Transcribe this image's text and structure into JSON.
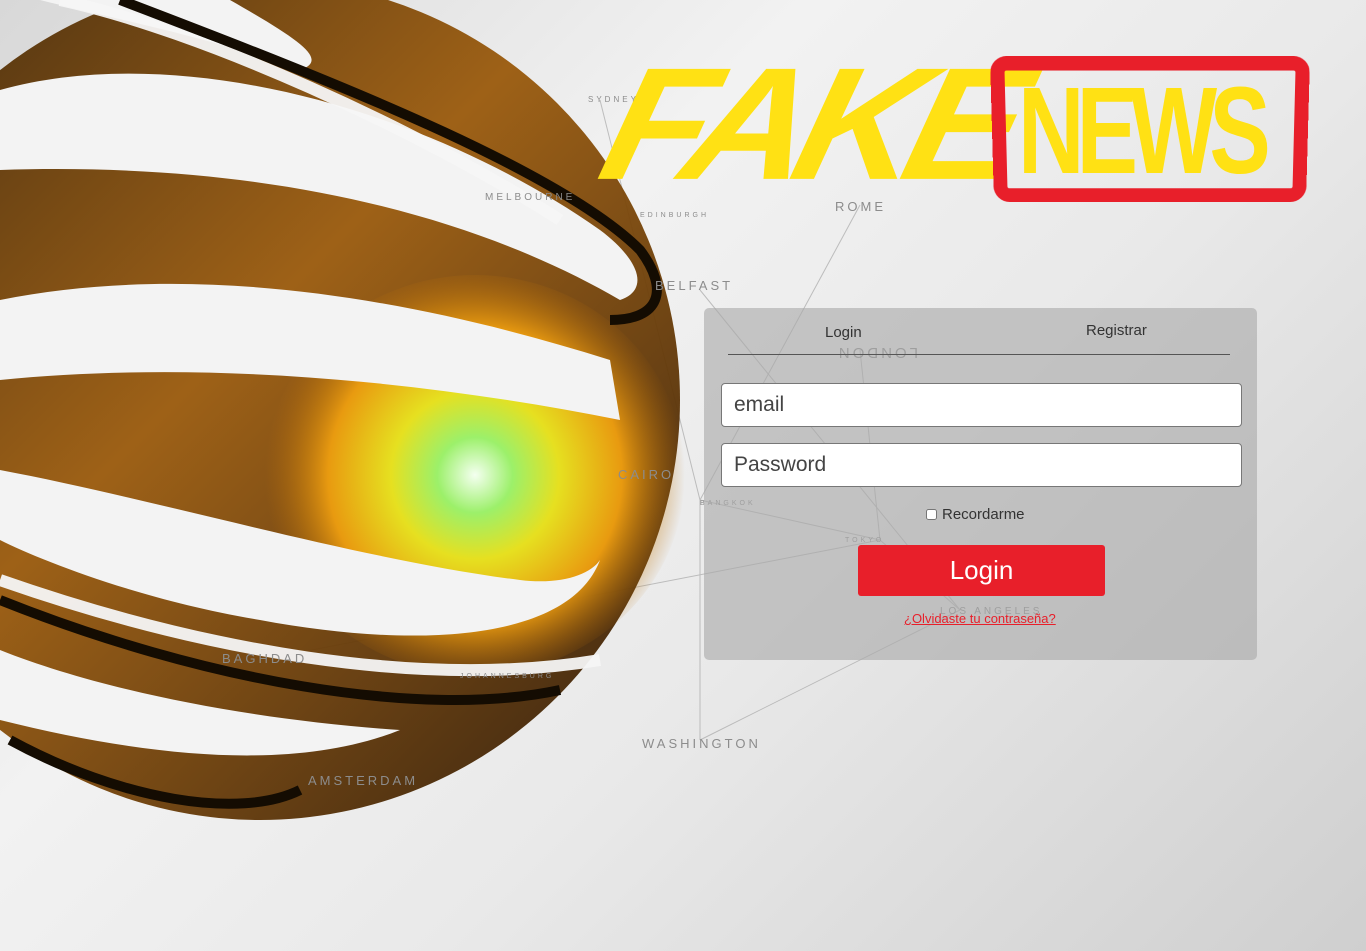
{
  "brand": {
    "logo_fake": "FAKE",
    "logo_news": "NEWS",
    "logo_yellow": "#ffe114",
    "logo_red": "#e81f2a"
  },
  "background": {
    "cities": [
      "SYDNEY",
      "MELBOURNE",
      "EDINBURGH",
      "ROME",
      "BELFAST",
      "LONDON",
      "CAIRO",
      "BANGKOK",
      "TOKYO",
      "LOS ANGELES",
      "BAGHDAD",
      "JOHANNESBURG",
      "WASHINGTON",
      "AMSTERDAM"
    ]
  },
  "login_panel": {
    "tabs": [
      {
        "label": "Login"
      },
      {
        "label": "Registrar"
      }
    ],
    "email_placeholder": "email",
    "password_placeholder": "Password",
    "remember_label": "Recordarme",
    "submit_label": "Login",
    "forgot_label": "¿Olvidaste tu contraseña?",
    "accent_color": "#e81f2a"
  }
}
